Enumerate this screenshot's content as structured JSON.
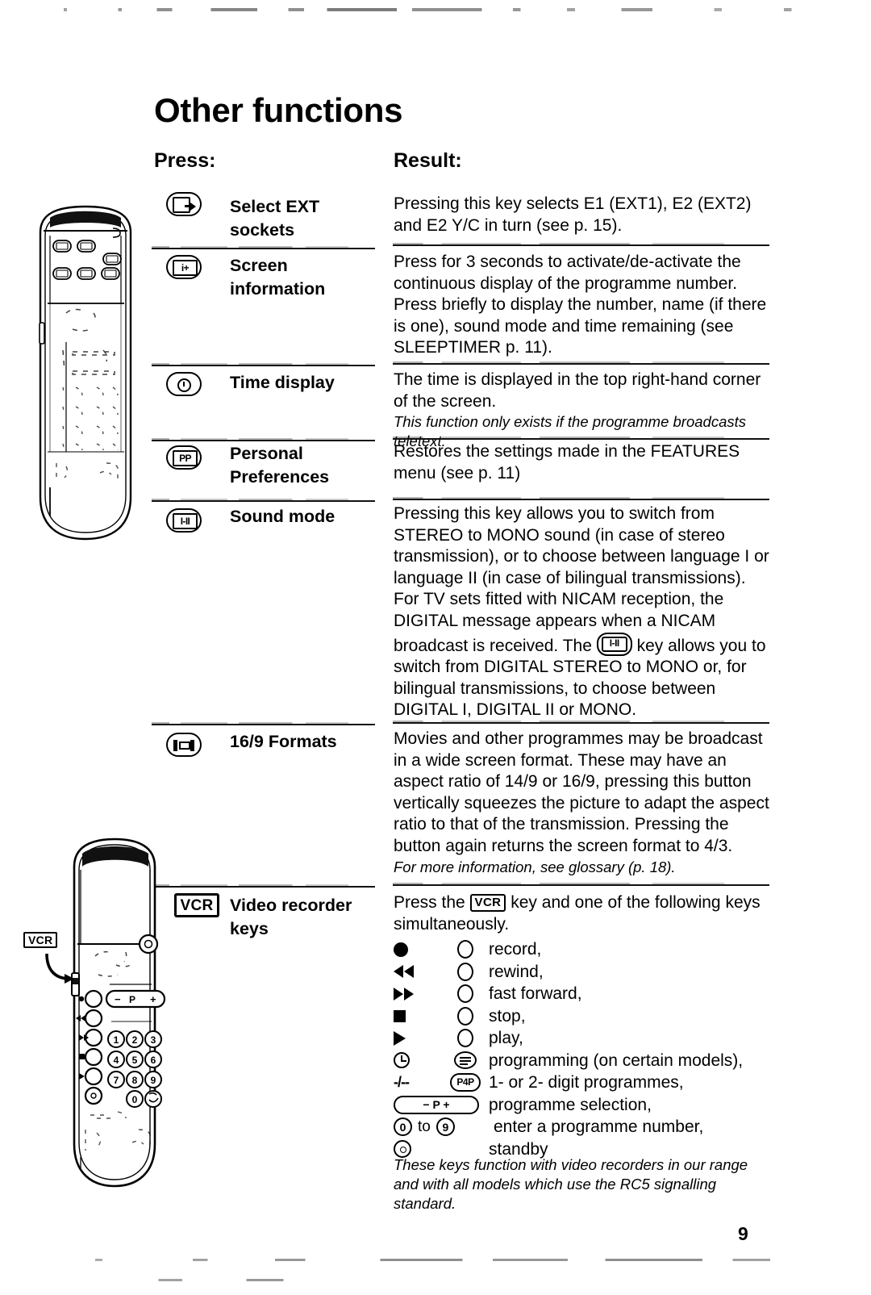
{
  "page": {
    "title": "Other functions",
    "number": "9"
  },
  "columns": {
    "press": "Press:",
    "result": "Result:"
  },
  "rows": [
    {
      "icon": "ext-sockets-icon",
      "icon_text": "",
      "label": "Select EXT sockets",
      "label_line1": "Select EXT",
      "label_line2": "sockets",
      "result": "Pressing this key selects E1 (EXT1), E2 (EXT2) and E2 Y/C in turn (see p. 15).",
      "note": ""
    },
    {
      "icon": "screen-information-icon",
      "icon_text": "i+",
      "label": "Screen information",
      "label_line1": "Screen",
      "label_line2": "information",
      "result": "Press for 3 seconds to activate/de-activate the continuous display of the programme number. Press briefly to display the number, name (if there is one), sound mode and time remaining (see SLEEPTIMER p. 11).",
      "note": ""
    },
    {
      "icon": "time-display-icon",
      "icon_text": "",
      "label": "Time display",
      "label_line1": "Time display",
      "label_line2": "",
      "result": "The time is displayed in the top right-hand corner of the screen.",
      "note": "This function only exists if the programme broadcasts teletext."
    },
    {
      "icon": "personal-preferences-icon",
      "icon_text": "PP",
      "label": "Personal Preferences",
      "label_line1": "Personal",
      "label_line2": "Preferences",
      "result": "Restores the settings made in the FEATURES menu (see p. 11)",
      "note": ""
    },
    {
      "icon": "sound-mode-icon",
      "icon_text": "I-II",
      "label": "Sound mode",
      "label_line1": "Sound mode",
      "label_line2": "",
      "result_part1": "Pressing this key allows you to switch from STEREO to MONO sound (in case of stereo transmission), or to choose between language I or language II (in case of bilingual transmissions). For TV sets fitted with NICAM reception, the DIGITAL message appears when a NICAM broadcast is received. The ",
      "result_part2": " key allows you to switch from DIGITAL STEREO to MONO or, for bilingual transmissions, to choose between DIGITAL I, DIGITAL II or MONO.",
      "inline_key": "I-II",
      "note": ""
    },
    {
      "icon": "wide-screen-format-icon",
      "icon_text": "",
      "label": "16/9 Formats",
      "label_line1": "16/9 Formats",
      "label_line2": "",
      "result": "Movies and other programmes may be broadcast in a wide screen format. These may have an aspect ratio of 14/9 or 16/9, pressing this button vertically squeezes the picture to adapt the aspect ratio to that of the transmission. Pressing the button again returns the screen format to 4/3.",
      "note": "For more information, see glossary (p. 18)."
    }
  ],
  "vcr_row": {
    "icon": "vcr-key-icon",
    "icon_text": "VCR",
    "label_line1": "Video recorder",
    "label_line2": "keys",
    "intro_part1": "Press the ",
    "intro_key": "VCR",
    "intro_part2": " key and one of the following keys simultaneously.",
    "keys": [
      {
        "symbol": "record-dot-icon",
        "mid": "circle-icon",
        "description": "record,"
      },
      {
        "symbol": "rewind-icon",
        "mid": "circle-icon",
        "description": "rewind,"
      },
      {
        "symbol": "fast-forward-icon",
        "mid": "circle-icon",
        "description": "fast forward,"
      },
      {
        "symbol": "stop-icon",
        "mid": "circle-icon",
        "description": "stop,"
      },
      {
        "symbol": "play-icon",
        "mid": "circle-icon",
        "description": "play,"
      },
      {
        "symbol": "clock-icon",
        "mid": "programming-icon",
        "description": "programming (on certain models),"
      },
      {
        "symbol": "digit-toggle-icon",
        "symbol_text": "-/--",
        "mid": "prev-programme-icon",
        "mid_text": "P4P",
        "description": "1- or 2- digit programmes,"
      },
      {
        "symbol": "programme-rocker-icon",
        "symbol_text": "−  P  +",
        "mid": "",
        "description": "programme selection,"
      },
      {
        "symbol": "digit-range-icon",
        "symbol_text_a": "0",
        "symbol_text_mid": "to",
        "symbol_text_b": "9",
        "mid": "",
        "description": "enter a programme number,"
      },
      {
        "symbol": "standby-icon",
        "mid": "",
        "description": "standby"
      }
    ],
    "footnote": "These keys function with video recorders in our range and with all models which use the RC5 signalling standard."
  },
  "illustrations": {
    "remote_top": {
      "name": "tv-remote-control-illustration"
    },
    "remote_bottom": {
      "name": "vcr-remote-control-illustration",
      "callout_label": "VCR",
      "rocker_minus": "−",
      "rocker_p": "P",
      "rocker_plus": "+",
      "keypad": [
        "1",
        "2",
        "3",
        "4",
        "5",
        "6",
        "7",
        "8",
        "9",
        "0"
      ]
    }
  },
  "colors": {
    "ink": "#000000",
    "paper": "#ffffff"
  }
}
